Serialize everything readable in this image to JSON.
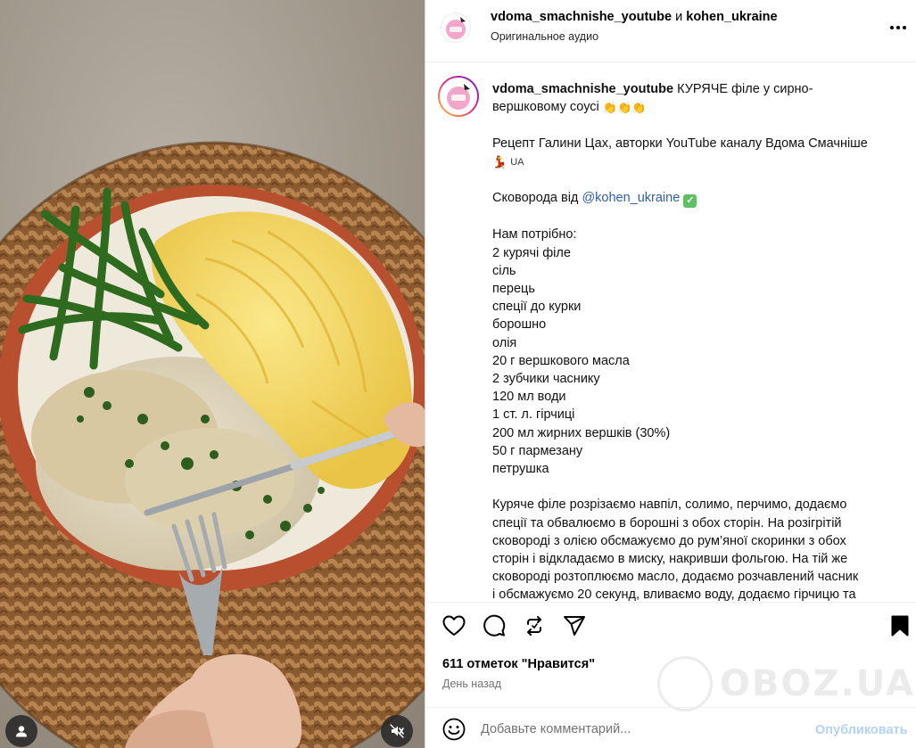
{
  "post": {
    "header": {
      "author": "vdoma_smachnishe_youtube",
      "joiner": "и",
      "collaborator": "kohen_ukraine",
      "audio": "Оригинальное аудио"
    },
    "caption": {
      "author": "vdoma_smachnishe_youtube",
      "title_line1": "КУРЯЧЕ філе у сирно-",
      "title_line2": "вершковому соусі",
      "title_emoji": "👏👏👏",
      "recipe_by": "Рецепт Галини Цах, авторки YouTube каналу Вдома Смачніше",
      "flag_emoji": "💃",
      "flag_text": "UA",
      "pan_prefix": "Сковорода від",
      "pan_mention": "@kohen_ukraine",
      "check_mark": "✓",
      "ingredients_title": "Нам потрібно:",
      "ingredients": [
        "2 курячі філе",
        "сіль",
        "перець",
        "спеції до курки",
        "борошно",
        "олія",
        "20 г вершкового масла",
        "2 зубчики часнику",
        "120 мл води",
        "1 ст. л. гірчиці",
        "200 мл жирних вершків (30%)",
        "50 г пармезану",
        "петрушка"
      ],
      "steps": [
        "Куряче філе розрізаємо навпіл, солимо, перчимо, додаємо",
        "спеції та обвалюємо в борошні з обох сторін. На розігрітій",
        "сковороді з олією обсмажуємо до рум’яної скоринки з обох",
        "сторін і відкладаємо в миску, накривши фольгою. На тій же",
        "сковороді розтоплюємо масло, додаємо розчавлений часник",
        "і обсмажуємо 20 секунд, вливаємо воду, додаємо гірчицю та"
      ]
    },
    "likes": "611 отметок \"Нравится\"",
    "time_ago": "День назад",
    "comment": {
      "placeholder": "Добавьте комментарий...",
      "value": "",
      "publish_label": "Опубликовать"
    },
    "watermark": "OBOZ.UA"
  },
  "icons": {
    "more": "more-horizontal-icon",
    "like": "heart-icon",
    "comment": "comment-icon",
    "share": "repost-icon",
    "send": "send-icon",
    "save": "bookmark-icon",
    "emoji": "smiley-icon",
    "tagged_users": "user-icon",
    "mute": "speaker-muted-icon"
  },
  "colors": {
    "mention": "#2f5fa8",
    "publish_disabled": "#b3d2f6",
    "secondary_text": "#737373",
    "story_ring_start": "#f9ce34",
    "story_ring_end": "#6228d7"
  }
}
